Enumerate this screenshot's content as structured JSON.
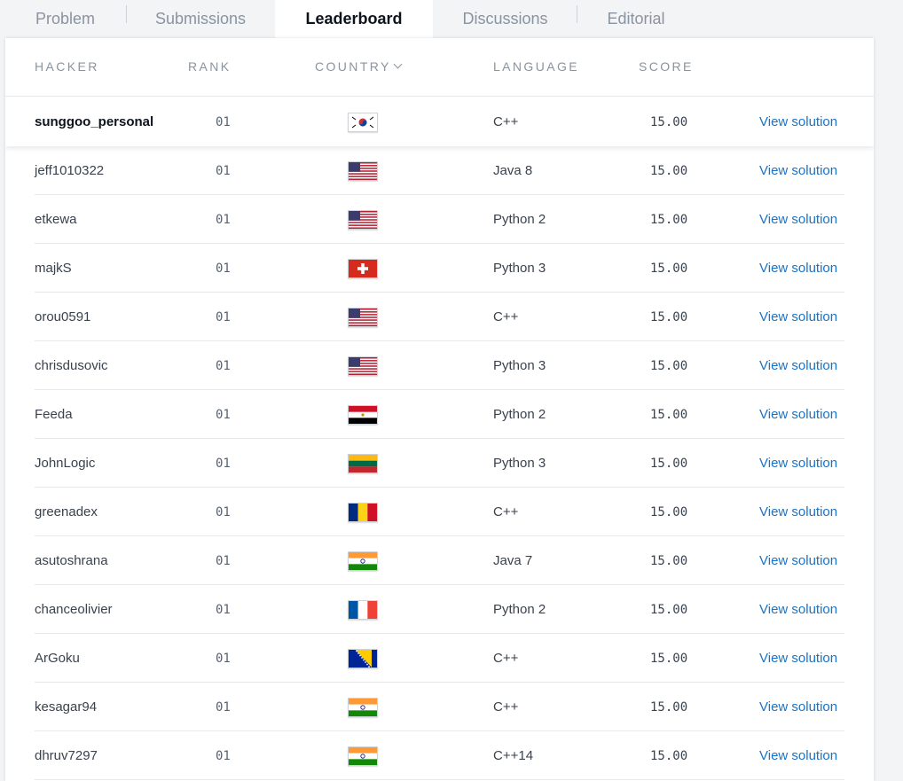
{
  "tabs": [
    {
      "label": "Problem",
      "active": false
    },
    {
      "label": "Submissions",
      "active": false
    },
    {
      "label": "Leaderboard",
      "active": true
    },
    {
      "label": "Discussions",
      "active": false
    },
    {
      "label": "Editorial",
      "active": false
    }
  ],
  "table": {
    "headers": {
      "hacker": "HACKER",
      "rank": "RANK",
      "country": "COUNTRY",
      "language": "LANGUAGE",
      "score": "SCORE"
    },
    "rows": [
      {
        "hacker": "sunggoo_personal",
        "rank": "01",
        "flag": "kr-flag-icon",
        "language": "C++",
        "score": "15.00",
        "action": "View solution"
      },
      {
        "hacker": "jeff1010322",
        "rank": "01",
        "flag": "us-flag-icon",
        "language": "Java 8",
        "score": "15.00",
        "action": "View solution"
      },
      {
        "hacker": "etkewa",
        "rank": "01",
        "flag": "us-flag-icon",
        "language": "Python 2",
        "score": "15.00",
        "action": "View solution"
      },
      {
        "hacker": "majkS",
        "rank": "01",
        "flag": "ch-flag-icon",
        "language": "Python 3",
        "score": "15.00",
        "action": "View solution"
      },
      {
        "hacker": "orou0591",
        "rank": "01",
        "flag": "us-flag-icon",
        "language": "C++",
        "score": "15.00",
        "action": "View solution"
      },
      {
        "hacker": "chrisdusovic",
        "rank": "01",
        "flag": "us-flag-icon",
        "language": "Python 3",
        "score": "15.00",
        "action": "View solution"
      },
      {
        "hacker": "Feeda",
        "rank": "01",
        "flag": "eg-flag-icon",
        "language": "Python 2",
        "score": "15.00",
        "action": "View solution"
      },
      {
        "hacker": "JohnLogic",
        "rank": "01",
        "flag": "lt-flag-icon",
        "language": "Python 3",
        "score": "15.00",
        "action": "View solution"
      },
      {
        "hacker": "greenadex",
        "rank": "01",
        "flag": "ro-flag-icon",
        "language": "C++",
        "score": "15.00",
        "action": "View solution"
      },
      {
        "hacker": "asutoshrana",
        "rank": "01",
        "flag": "in-flag-icon",
        "language": "Java 7",
        "score": "15.00",
        "action": "View solution"
      },
      {
        "hacker": "chanceolivier",
        "rank": "01",
        "flag": "fr-flag-icon",
        "language": "Python 2",
        "score": "15.00",
        "action": "View solution"
      },
      {
        "hacker": "ArGoku",
        "rank": "01",
        "flag": "ba-flag-icon",
        "language": "C++",
        "score": "15.00",
        "action": "View solution"
      },
      {
        "hacker": "kesagar94",
        "rank": "01",
        "flag": "in-flag-icon",
        "language": "C++",
        "score": "15.00",
        "action": "View solution"
      },
      {
        "hacker": "dhruv7297",
        "rank": "01",
        "flag": "in-flag-icon",
        "language": "C++14",
        "score": "15.00",
        "action": "View solution"
      }
    ]
  },
  "colors": {
    "link": "#1a73c6",
    "text": "#39424e",
    "header_text": "#8a93a0",
    "background": "#f3f4f6"
  }
}
